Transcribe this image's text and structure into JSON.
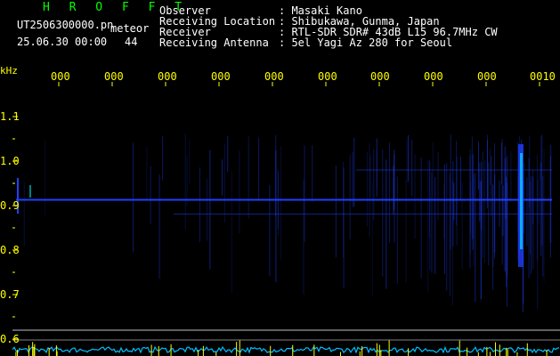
{
  "header": {
    "app_name": "H R O F F T",
    "filename": "UT2506300000.pn",
    "meteor_label": "meteor",
    "datetime": "25.06.30 00:00",
    "meteor_count": "44"
  },
  "meta": [
    {
      "key": "Observer",
      "value": ": Masaki Kano"
    },
    {
      "key": "Receiving Location",
      "value": ": Shibukawa, Gunma, Japan"
    },
    {
      "key": "Receiver",
      "value": ": RTL-SDR SDR# 43dB L15 96.7MHz CW"
    },
    {
      "key": "Receiving Antenna",
      "value": ": 5el Yagi Az 280 for Seoul"
    }
  ],
  "time_ticks": [
    "000",
    "000",
    "000",
    "000",
    "000",
    "000",
    "000",
    "000",
    "000",
    "0010"
  ],
  "y_axis": {
    "unit": "kHz",
    "labels": [
      "1.1",
      "1.0",
      "0.9",
      "0.8",
      "0.7",
      "0.6"
    ]
  },
  "chart_data": {
    "type": "heatmap",
    "ylabel": "kHz",
    "ylim": [
      0.6,
      1.1
    ],
    "carrier_frequency_khz": 0.913,
    "colors": {
      "background": "#000000",
      "signal": "#2040ff",
      "signal_peak": "#00ffff",
      "labels": "#ffff00",
      "baseline": "#00c0ff"
    }
  }
}
